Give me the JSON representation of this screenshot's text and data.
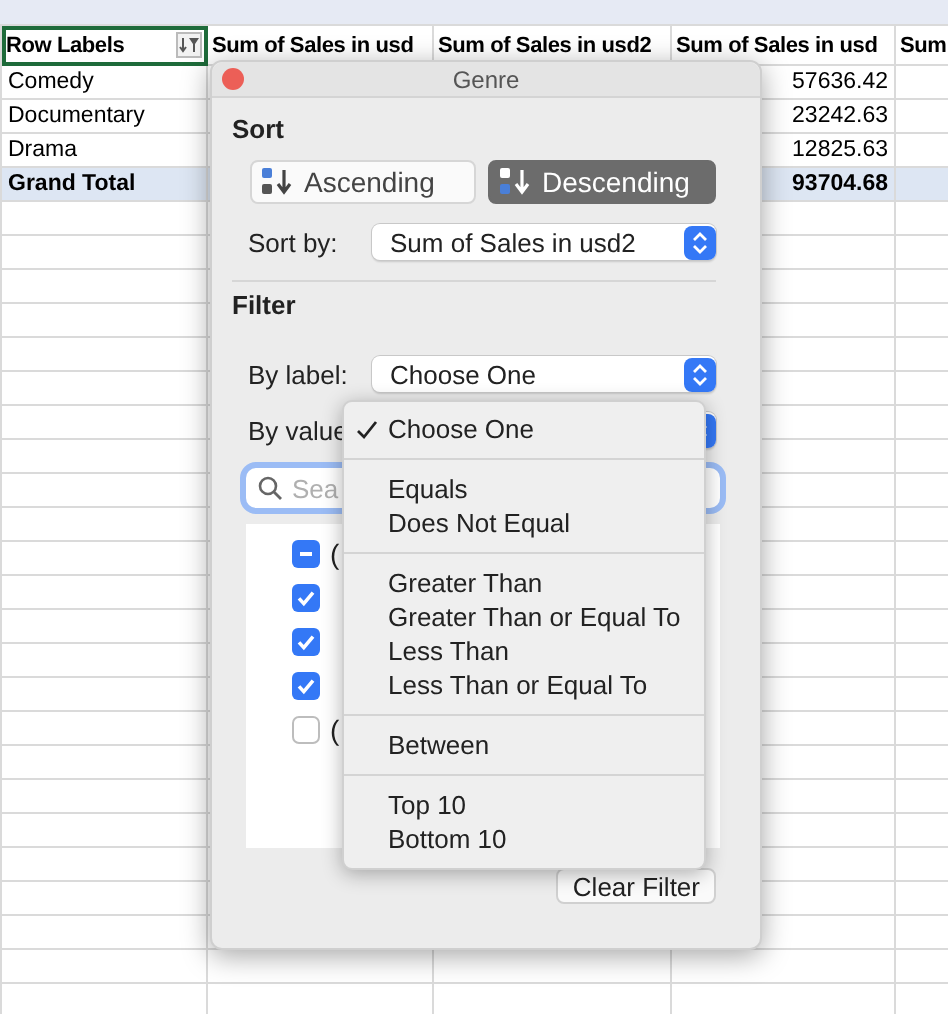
{
  "sheet": {
    "columns": [
      {
        "label": "Row Labels",
        "selected": true
      },
      {
        "label": "Sum of Sales in usd",
        "selected": false
      },
      {
        "label": "Sum of Sales in usd2",
        "selected": false
      },
      {
        "label": "Sum of Sales in usd",
        "selected": false
      },
      {
        "label": "Sum",
        "selected": false
      }
    ],
    "rows": [
      {
        "kind": "item",
        "label": "Comedy",
        "column_4": "57636.42"
      },
      {
        "kind": "item",
        "label": "Documentary",
        "column_4": "23242.63"
      },
      {
        "kind": "item",
        "label": "Drama",
        "column_4": "12825.63"
      },
      {
        "kind": "total",
        "label": "Grand Total",
        "column_4": "93704.68"
      }
    ]
  },
  "popup": {
    "title": "Genre",
    "sort": {
      "heading": "Sort",
      "options": [
        {
          "label": "Ascending",
          "selected": false
        },
        {
          "label": "Descending",
          "selected": true
        }
      ],
      "sort_by_label": "Sort by:",
      "sort_by_value": "Sum of Sales in usd2"
    },
    "filter": {
      "heading": "Filter",
      "by_label_label": "By label:",
      "by_label_value": "Choose One",
      "by_value_label": "By value",
      "search_placeholder": "Sea",
      "items": [
        {
          "text": "(",
          "checked": true,
          "mixed": true
        },
        {
          "checked": true,
          "mixed": false
        },
        {
          "checked": true,
          "mixed": false
        },
        {
          "checked": true,
          "mixed": false
        },
        {
          "text": "(",
          "checked": false,
          "mixed": false
        }
      ]
    },
    "clear_button": "Clear Filter"
  },
  "menu": {
    "groups": [
      {
        "items": [
          {
            "label": "Choose One",
            "selected": true
          }
        ]
      },
      {
        "items": [
          {
            "label": "Equals",
            "selected": false
          },
          {
            "label": "Does Not Equal",
            "selected": false
          }
        ]
      },
      {
        "items": [
          {
            "label": "Greater Than",
            "selected": false
          },
          {
            "label": "Greater Than or Equal To",
            "selected": false
          },
          {
            "label": "Less Than",
            "selected": false
          },
          {
            "label": "Less Than or Equal To",
            "selected": false
          }
        ]
      },
      {
        "items": [
          {
            "label": "Between",
            "selected": false
          }
        ]
      },
      {
        "items": [
          {
            "label": "Top 10",
            "selected": false
          },
          {
            "label": "Bottom 10",
            "selected": false
          }
        ]
      }
    ]
  }
}
